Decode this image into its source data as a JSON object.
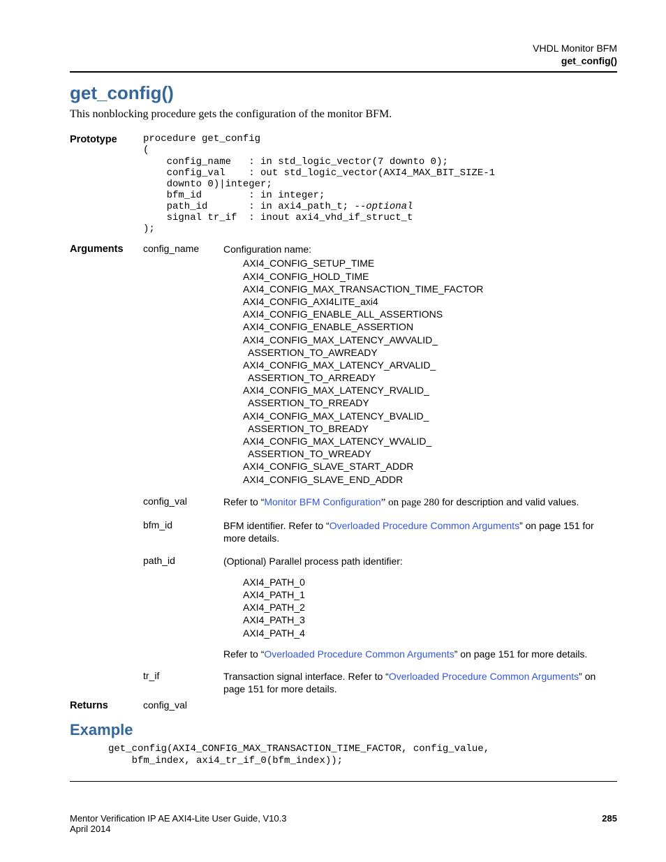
{
  "header": {
    "line1": "VHDL Monitor BFM",
    "line2": "get_config()"
  },
  "title": "get_config()",
  "intro": "This nonblocking procedure gets the configuration of the monitor BFM.",
  "prototype": {
    "label": "Prototype",
    "code_prefix": "procedure get_config\n(\n    config_name   : in std_logic_vector(7 downto 0);\n    config_val    : out std_logic_vector(AXI4_MAX_BIT_SIZE-1\n    downto 0)|integer;\n    bfm_id        : in integer;\n    path_id       : in axi4_path_t; ",
    "code_italic": "--optional",
    "code_suffix": "\n    signal tr_if  : inout axi4_vhd_if_struct_t\n);"
  },
  "arguments": {
    "label": "Arguments",
    "items": [
      {
        "name": "config_name",
        "desc_lead": "Configuration name:",
        "list": [
          "AXI4_CONFIG_SETUP_TIME",
          "AXI4_CONFIG_HOLD_TIME",
          "AXI4_CONFIG_MAX_TRANSACTION_TIME_FACTOR",
          "AXI4_CONFIG_AXI4LITE_axi4",
          "AXI4_CONFIG_ENABLE_ALL_ASSERTIONS",
          "AXI4_CONFIG_ENABLE_ASSERTION",
          "AXI4_CONFIG_MAX_LATENCY_AWVALID_",
          "  ASSERTION_TO_AWREADY",
          "AXI4_CONFIG_MAX_LATENCY_ARVALID_",
          "  ASSERTION_TO_ARREADY",
          "AXI4_CONFIG_MAX_LATENCY_RVALID_",
          "  ASSERTION_TO_RREADY",
          "AXI4_CONFIG_MAX_LATENCY_BVALID_",
          "  ASSERTION_TO_BREADY",
          "AXI4_CONFIG_MAX_LATENCY_WVALID_",
          "  ASSERTION_TO_WREADY",
          "AXI4_CONFIG_SLAVE_START_ADDR",
          "AXI4_CONFIG_SLAVE_END_ADDR"
        ]
      },
      {
        "name": "config_val",
        "pre": "Refer to “",
        "link": "Monitor BFM Configuration",
        "post_serif": "” on page 280",
        "tail": " for description and valid values."
      },
      {
        "name": "bfm_id",
        "pre": "BFM identifier. Refer to “",
        "link": "Overloaded Procedure Common Arguments",
        "tail": "” on page 151 for more details."
      },
      {
        "name": "path_id",
        "desc_lead": "(Optional) Parallel process path identifier:",
        "list": [
          "AXI4_PATH_0",
          "AXI4_PATH_1",
          "AXI4_PATH_2",
          "AXI4_PATH_3",
          "AXI4_PATH_4"
        ],
        "post_pre": "Refer to “",
        "post_link": "Overloaded Procedure Common Arguments",
        "post_tail": "” on page 151 for more details."
      },
      {
        "name": "tr_if",
        "pre": "Transaction signal interface. Refer to “",
        "link": "Overloaded Procedure Common Arguments",
        "tail": "” on page 151 for more details."
      }
    ]
  },
  "returns": {
    "label": "Returns",
    "value": "config_val"
  },
  "example": {
    "heading": "Example",
    "code": "get_config(AXI4_CONFIG_MAX_TRANSACTION_TIME_FACTOR, config_value,\n    bfm_index, axi4_tr_if_0(bfm_index));"
  },
  "footer": {
    "left1": "Mentor Verification IP AE AXI4-Lite User Guide, V10.3",
    "left2": "April 2014",
    "right": "285"
  }
}
